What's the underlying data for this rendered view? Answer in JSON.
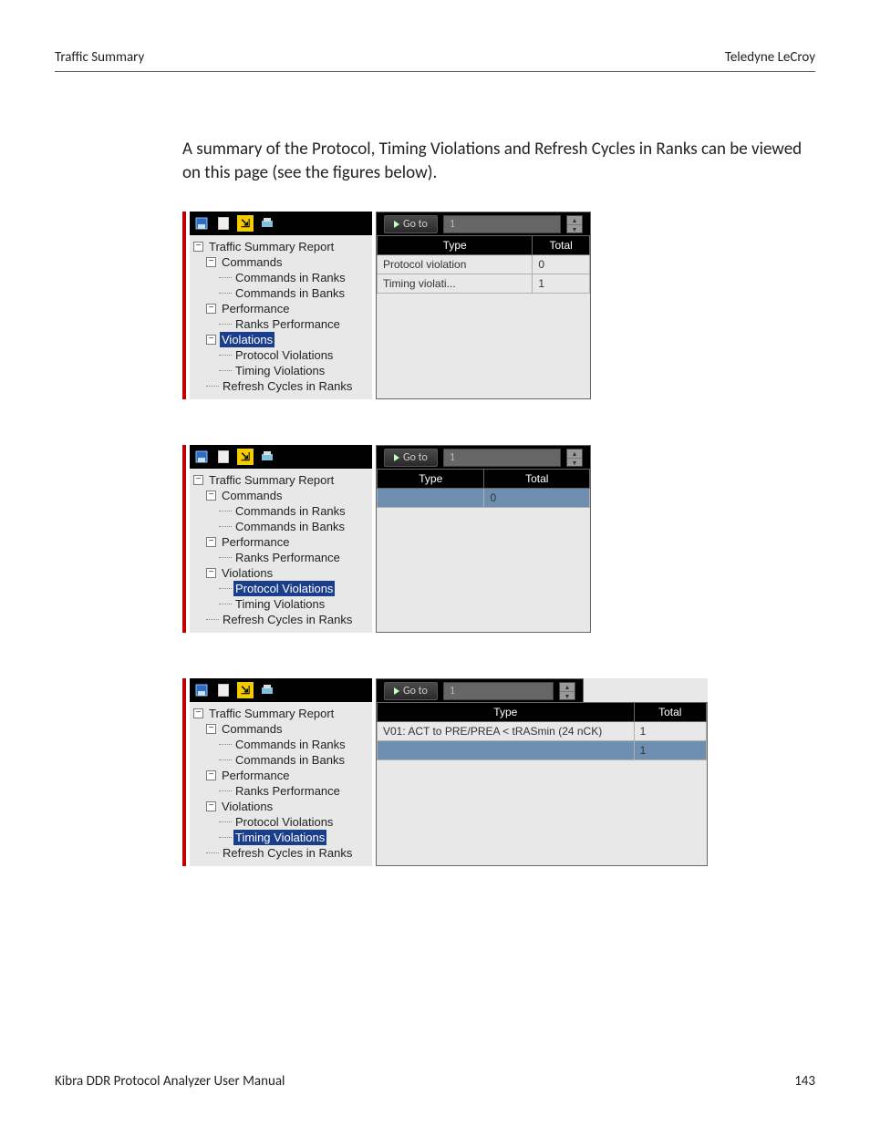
{
  "header": {
    "left": "Traffic Summary",
    "right": "Teledyne LeCroy"
  },
  "intro": "A summary of the Protocol, Timing Violations and Refresh Cycles in Ranks can be viewed on this page (see the figures below).",
  "goto_label": "Go to",
  "goto_value": "1",
  "tree": {
    "root": "Traffic Summary Report",
    "commands": "Commands",
    "commands_ranks": "Commands in Ranks",
    "commands_banks": "Commands in Banks",
    "performance": "Performance",
    "ranks_performance": "Ranks Performance",
    "violations": "Violations",
    "protocol_violations": "Protocol Violations",
    "timing_violations": "Timing Violations",
    "refresh_cycles": "Refresh Cycles in Ranks"
  },
  "fig1": {
    "headers": [
      "Type",
      "Total"
    ],
    "rows": [
      [
        "Protocol violation",
        "0"
      ],
      [
        "Timing violati...",
        "1"
      ]
    ]
  },
  "fig2": {
    "headers": [
      "Type",
      "Total"
    ],
    "rows": [
      [
        "",
        "0"
      ]
    ]
  },
  "fig3": {
    "headers": [
      "Type",
      "Total"
    ],
    "rows": [
      [
        "V01: ACT to PRE/PREA < tRASmin (24 nCK)",
        "1"
      ],
      [
        "",
        "1"
      ]
    ]
  },
  "footer": {
    "left": "Kibra DDR Protocol Analyzer User Manual",
    "right": "143"
  }
}
